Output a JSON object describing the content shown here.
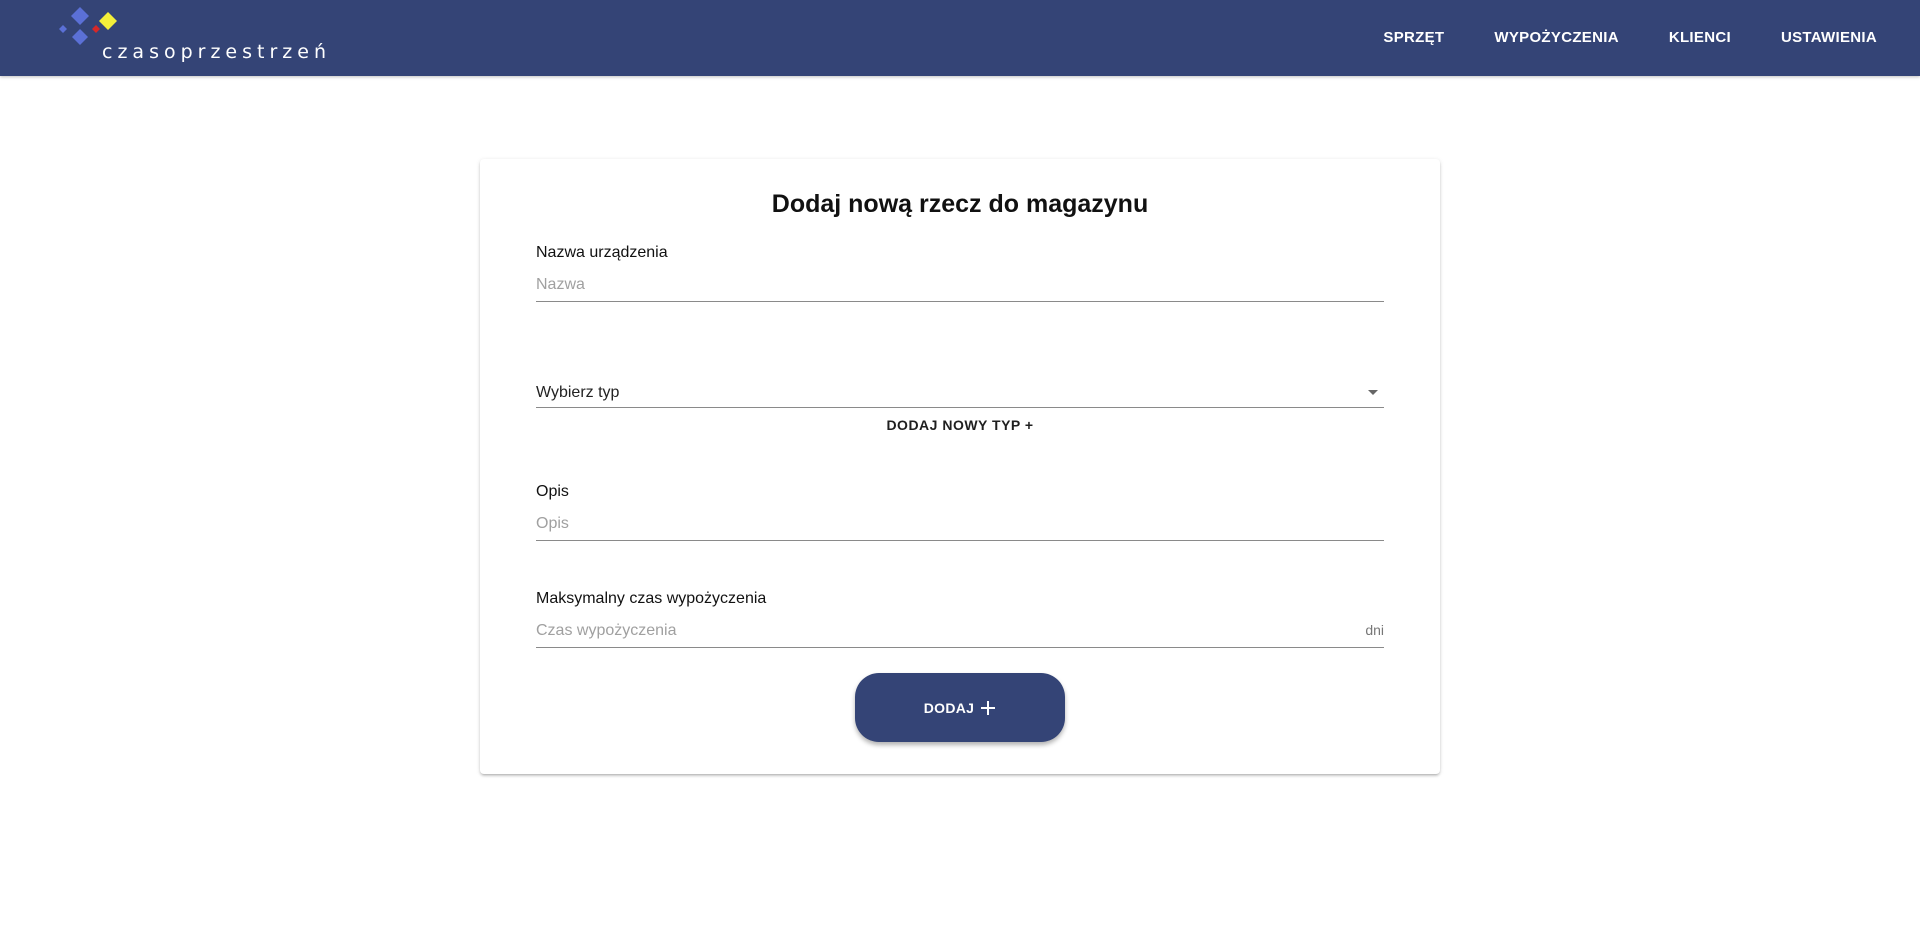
{
  "brand": {
    "name": "czasoprzestrzeń",
    "colors": {
      "blue": "#5b70d6",
      "yellow": "#f3ef3a",
      "red": "#d62828",
      "navy": "#344476"
    }
  },
  "nav": {
    "items": [
      "SPRZĘT",
      "WYPOŻYCZENIA",
      "KLIENCI",
      "USTAWIENIA"
    ]
  },
  "form": {
    "title": "Dodaj nową rzecz do magazynu",
    "name_label": "Nazwa urządzenia",
    "name_placeholder": "Nazwa",
    "type_select": "Wybierz typ",
    "add_type": "DODAJ NOWY TYP +",
    "desc_label": "Opis",
    "desc_placeholder": "Opis",
    "max_time_label": "Maksymalny czas wypożyczenia",
    "max_time_placeholder": "Czas wypożyczenia",
    "max_time_unit": "dni",
    "submit": "DODAJ"
  },
  "icons": {
    "select": "chevron-down-icon",
    "submit": "plus-icon"
  }
}
